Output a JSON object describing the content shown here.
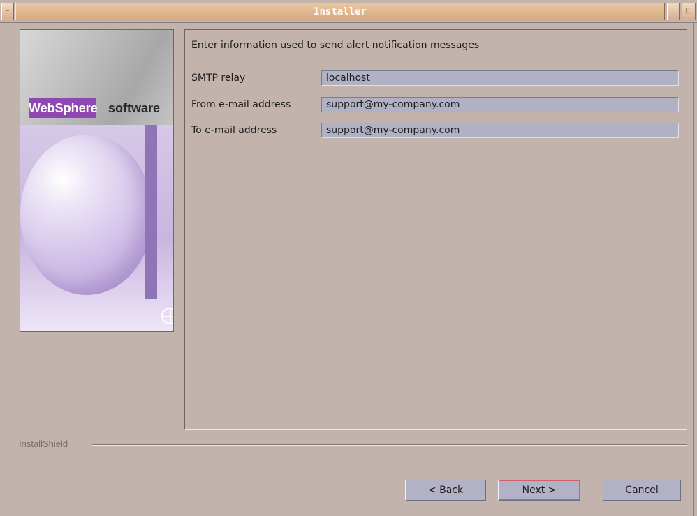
{
  "window": {
    "title": "Installer"
  },
  "left_panel": {
    "brand_name": "WebSphere",
    "brand_suffix": "software"
  },
  "main": {
    "header": "Enter information used to send alert notification messages",
    "fields": [
      {
        "label": "SMTP relay",
        "value": "localhost"
      },
      {
        "label": "From e-mail address",
        "value": "support@my-company.com"
      },
      {
        "label": "To e-mail address",
        "value": "support@my-company.com"
      }
    ]
  },
  "footer": {
    "brand": "InstallShield"
  },
  "buttons": {
    "back": {
      "before": "< ",
      "mnemonic": "B",
      "after": "ack"
    },
    "next": {
      "mnemonic": "N",
      "after": "ext >"
    },
    "cancel": {
      "mnemonic": "C",
      "after": "ancel"
    }
  },
  "colors": {
    "window_bg": "#c3b3ad",
    "title_accent": "#d8aa82",
    "input_bg": "#b0b1c4",
    "button_bg": "#b2b1c6"
  }
}
